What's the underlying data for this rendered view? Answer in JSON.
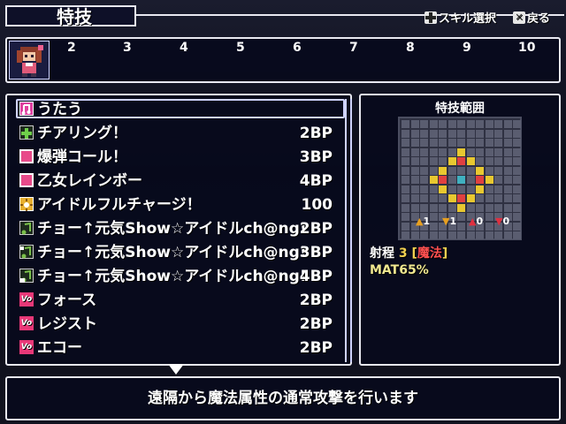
{
  "title": "特技",
  "hints": {
    "select_label": "スキル選択",
    "back_label": "戻る",
    "select_icon": "dpad-icon",
    "back_icon": "x-button-icon"
  },
  "party_slots": [
    "2",
    "3",
    "4",
    "5",
    "6",
    "7",
    "8",
    "9",
    "10"
  ],
  "skills": [
    {
      "name": "うたう",
      "cost": "",
      "icon": "music-note-icon",
      "icon_color": "#e040a0"
    },
    {
      "name": "チアリング！",
      "cost": "2BP",
      "icon": "heal-plus-icon",
      "icon_color": "#6fcf4a"
    },
    {
      "name": "爆弾コール！",
      "cost": "3BP",
      "icon": "pink-square-icon",
      "icon_color": "#e84a8a"
    },
    {
      "name": "乙女レインボー",
      "cost": "4BP",
      "icon": "pink-square-icon",
      "icon_color": "#e84a8a"
    },
    {
      "name": "アイドルフルチャージ！",
      "cost": "100",
      "icon": "burst-icon",
      "icon_color": "#e8b030"
    },
    {
      "name": "チョー↑元気Show☆アイドルch@ng!",
      "cost": "2BP",
      "icon": "note-icon-1",
      "icon_color": "#7ac04a"
    },
    {
      "name": "チョー↑元気Show☆アイドルch@ng!",
      "cost": "3BP",
      "icon": "note-icon-2",
      "icon_color": "#7ac04a"
    },
    {
      "name": "チョー↑元気Show☆アイドルch@ng!",
      "cost": "4BP",
      "icon": "note-icon-3",
      "icon_color": "#7ac04a"
    },
    {
      "name": "フォース",
      "cost": "2BP",
      "icon": "vo-icon",
      "icon_color": "#e83878"
    },
    {
      "name": "レジスト",
      "cost": "2BP",
      "icon": "vo-icon",
      "icon_color": "#e83878"
    },
    {
      "name": "エコー",
      "cost": "2BP",
      "icon": "vo-icon",
      "icon_color": "#e83878"
    }
  ],
  "range": {
    "title": "特技範囲",
    "targets": [
      {
        "value": "1",
        "color": "#e8a020"
      },
      {
        "value": "1",
        "color": "#e8a020"
      },
      {
        "value": "0",
        "color": "#e03040"
      },
      {
        "value": "0",
        "color": "#e03040"
      }
    ],
    "range_label": "射程",
    "range_value": "3",
    "range_type_open": "[",
    "range_type": "魔法",
    "range_type_close": "]",
    "stat": "MAT65%"
  },
  "description": "遠隔から魔法属性の通常攻撃を行います",
  "colors": {
    "accent_yellow": "#f0d050",
    "accent_red": "#ff5050",
    "grid_highlight": "#e8c830",
    "grid_center": "#3fb0c0"
  }
}
